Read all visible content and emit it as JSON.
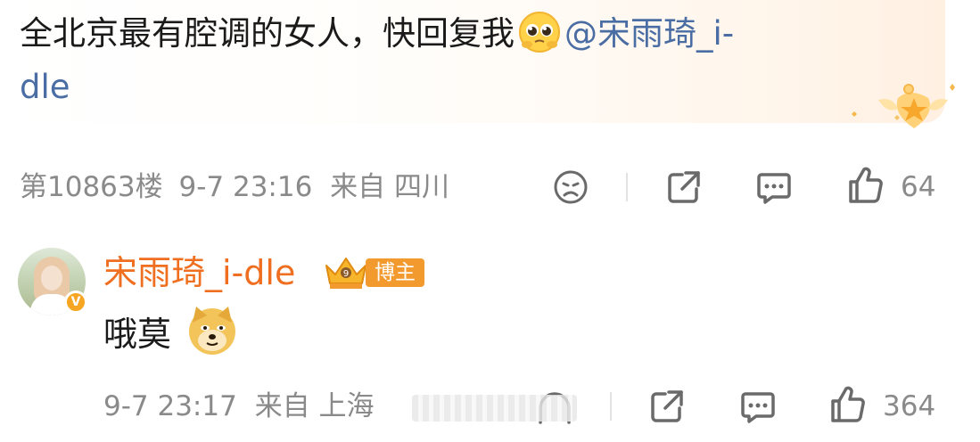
{
  "comment": {
    "text": "全北京最有腔调的女人，快回复我",
    "mention": "@宋雨琦_i-",
    "mention_tail": "dle",
    "emoji": "pleading-face",
    "floor": "第10863楼",
    "time": "9-7 23:16",
    "source": "来自 四川",
    "likes": "64"
  },
  "reply": {
    "author": "宋雨琦_i-dle",
    "role": "博主",
    "verified": "V",
    "text": "哦莫",
    "emoji": "doge",
    "time": "9-7 23:17",
    "source": "来自 上海",
    "likes": "364"
  },
  "colors": {
    "mention": "#4a6da3",
    "author": "#ef6e1f",
    "role_badge": "#f39a2e",
    "meta": "#8a8a8a"
  },
  "icons": [
    "sad-face-icon",
    "share-icon",
    "comment-icon",
    "thumbs-up-icon",
    "crown-badge-icon",
    "medal-badge-icon"
  ]
}
